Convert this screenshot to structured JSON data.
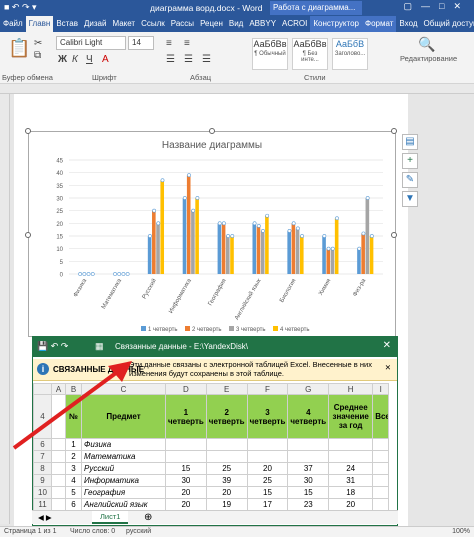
{
  "word": {
    "title": "диаграмма ворд.docx - Word",
    "context_tab_title": "Работа с диаграмма...",
    "tabs": [
      "Файл",
      "Главн",
      "Встав",
      "Дизай",
      "Макет",
      "Ссылк",
      "Рассы",
      "Рецен",
      "Вид",
      "ABBYY",
      "ACROI",
      "Конструктор",
      "Формат",
      "Вход",
      "Общий доступ"
    ],
    "active_tab": "Главн",
    "ribbon": {
      "font_name": "Calibri Light",
      "font_size": "14",
      "groups": [
        "Буфер обмена",
        "Шрифт",
        "Абзац",
        "Стили",
        "Редактирование"
      ],
      "styles": [
        {
          "preview": "АаБбВв",
          "name": "¶ Обычный"
        },
        {
          "preview": "АаБбВв",
          "name": "¶ Без инте..."
        },
        {
          "preview": "АаБбВ",
          "name": "Заголово..."
        }
      ],
      "edit_label": "Редактирование"
    },
    "status_bar": {
      "page": "Страница 1 из 1",
      "words": "Число слов: 0",
      "lang": "русский",
      "zoom": "100%"
    }
  },
  "chart_data": {
    "type": "bar",
    "title": "Название диаграммы",
    "categories": [
      "Физика",
      "Математика",
      "Русский",
      "Информатика",
      "География",
      "Английский язык",
      "Биология",
      "Химия",
      "Физ-ра"
    ],
    "ylim": [
      0,
      45
    ],
    "yticks": [
      0,
      5,
      10,
      15,
      20,
      25,
      30,
      35,
      40,
      45
    ],
    "series": [
      {
        "name": "1 четверть",
        "values": [
          0,
          0,
          15,
          30,
          20,
          20,
          17,
          15,
          10
        ]
      },
      {
        "name": "2 четверть",
        "values": [
          0,
          0,
          25,
          39,
          20,
          19,
          20,
          10,
          16
        ]
      },
      {
        "name": "3 четверть",
        "values": [
          0,
          0,
          20,
          25,
          15,
          17,
          18,
          10,
          30
        ]
      },
      {
        "name": "4 четверть",
        "values": [
          0,
          0,
          37,
          30,
          15,
          23,
          15,
          22,
          15
        ]
      }
    ],
    "colors": [
      "#5b9bd5",
      "#ed7d31",
      "#a5a5a5",
      "#ffc000"
    ],
    "legend_position": "bottom",
    "grid": true
  },
  "excel": {
    "title": "Связанные данные - E:\\YandexDisk\\",
    "info_label": "СВЯЗАННЫЕ ДАННЫЕ",
    "info_text": "Эти данные связаны с электронной таблицей Excel. Внесенные в них изменения будут сохранены в этой таблице.",
    "columns": [
      "A",
      "B",
      "C",
      "D",
      "E",
      "F",
      "G",
      "H",
      "I"
    ],
    "header_row": {
      "row": "4",
      "num": "№",
      "subject": "Предмет",
      "q1": "1 четверть",
      "q2": "2 четверть",
      "q3": "3 четверть",
      "q4": "4 четверть",
      "avg": "Среднее значение за год",
      "last": "Все"
    },
    "rows": [
      {
        "row": "6",
        "num": "1",
        "subject": "Физика",
        "q1": "",
        "q2": "",
        "q3": "",
        "q4": ""
      },
      {
        "row": "7",
        "num": "2",
        "subject": "Математика",
        "q1": "",
        "q2": "",
        "q3": "",
        "q4": ""
      },
      {
        "row": "8",
        "num": "3",
        "subject": "Русский",
        "q1": "15",
        "q2": "25",
        "q3": "20",
        "q4": "37",
        "avg": "24"
      },
      {
        "row": "9",
        "num": "4",
        "subject": "Информатика",
        "q1": "30",
        "q2": "39",
        "q3": "25",
        "q4": "30",
        "avg": "31"
      },
      {
        "row": "10",
        "num": "5",
        "subject": "География",
        "q1": "20",
        "q2": "20",
        "q3": "15",
        "q4": "15",
        "avg": "18"
      },
      {
        "row": "11",
        "num": "6",
        "subject": "Английский язык",
        "q1": "20",
        "q2": "19",
        "q3": "17",
        "q4": "23",
        "avg": "20"
      }
    ],
    "sheet_tab": "Лист1"
  }
}
